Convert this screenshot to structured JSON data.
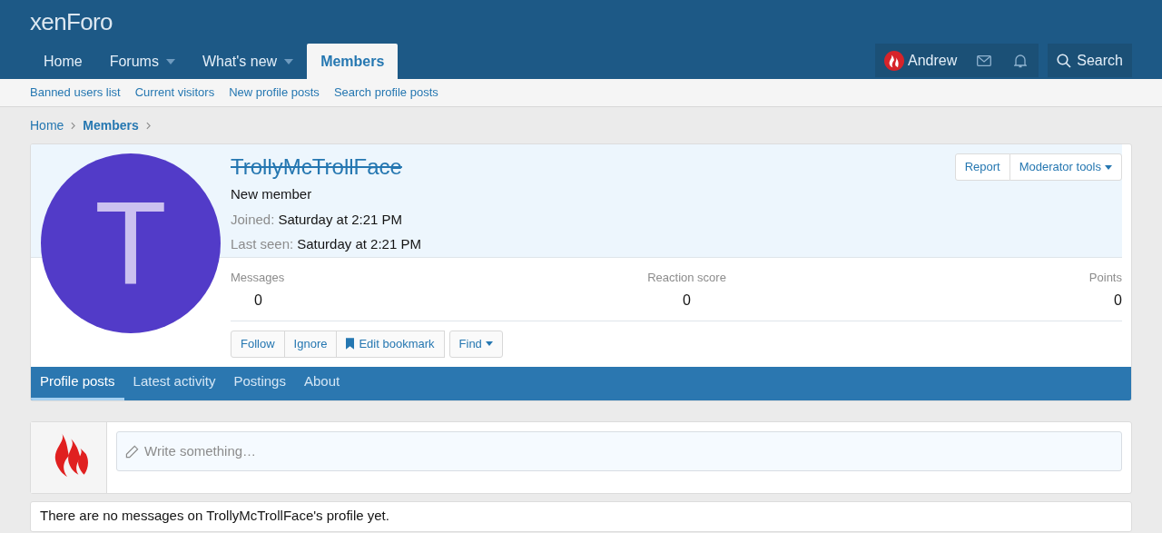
{
  "logo": "xenForo",
  "nav": {
    "tabs": [
      {
        "label": "Home",
        "selected": false,
        "dropdown": false
      },
      {
        "label": "Forums",
        "selected": false,
        "dropdown": true
      },
      {
        "label": "What's new",
        "selected": false,
        "dropdown": true
      },
      {
        "label": "Members",
        "selected": true,
        "dropdown": false
      }
    ],
    "user": "Andrew",
    "search": "Search"
  },
  "subnav": [
    "Banned users list",
    "Current visitors",
    "New profile posts",
    "Search profile posts"
  ],
  "breadcrumb": [
    {
      "label": "Home",
      "current": false
    },
    {
      "label": "Members",
      "current": true
    }
  ],
  "profile": {
    "avatar_letter": "T",
    "username": "TrollyMcTrollFace",
    "banned": true,
    "title": "New member",
    "details": [
      {
        "label": "Joined:",
        "value": "Saturday at 2:21 PM"
      },
      {
        "label": "Last seen:",
        "value": "Saturday at 2:21 PM"
      }
    ],
    "header_buttons": [
      {
        "label": "Report",
        "dropdown": false
      },
      {
        "label": "Moderator tools",
        "dropdown": true
      }
    ],
    "stats": [
      {
        "label": "Messages",
        "value": "0"
      },
      {
        "label": "Reaction score",
        "value": "0"
      },
      {
        "label": "Points",
        "value": "0"
      }
    ],
    "actions": [
      {
        "label": "Follow",
        "kind": "plain"
      },
      {
        "label": "Ignore",
        "kind": "plain"
      },
      {
        "label": "Edit bookmark",
        "kind": "bookmark"
      },
      {
        "label": "Find",
        "kind": "dropdown"
      }
    ],
    "tabs": [
      {
        "label": "Profile posts",
        "selected": true
      },
      {
        "label": "Latest activity",
        "selected": false
      },
      {
        "label": "Postings",
        "selected": false
      },
      {
        "label": "About",
        "selected": false
      }
    ]
  },
  "composer": {
    "placeholder": "Write something…"
  },
  "notice": "There are no messages on TrollyMcTrollFace's profile yet."
}
